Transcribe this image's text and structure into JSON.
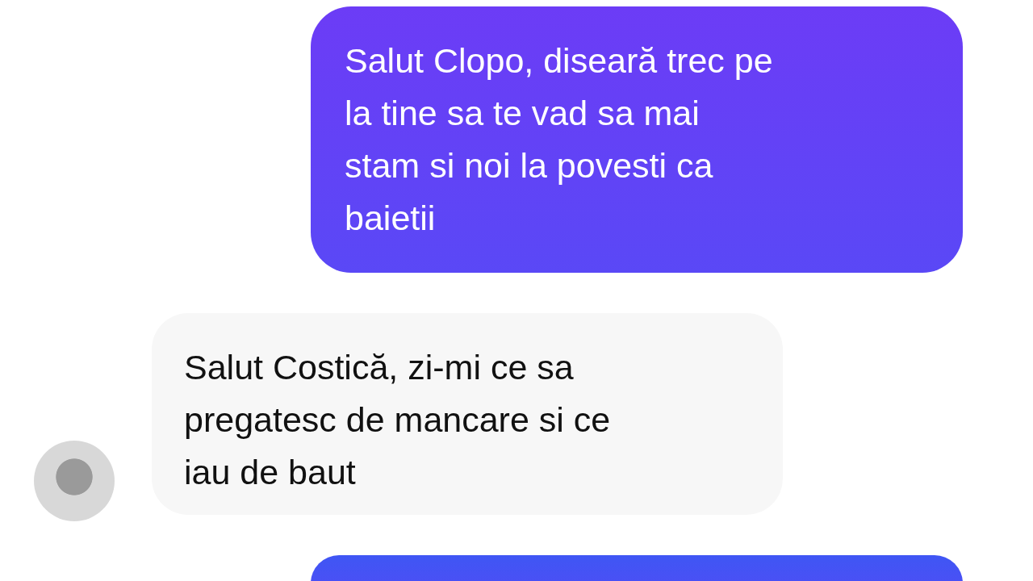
{
  "messages": [
    {
      "kind": "sent",
      "text": "Salut Clopo, diseară trec pe\nla tine sa te vad sa mai\nstam si noi la povesti ca\nbaietii"
    },
    {
      "kind": "received",
      "text": "Salut Costică, zi-mi ce sa\npregatesc de mancare si ce\niau de baut",
      "avatar": true
    },
    {
      "kind": "sent"
    }
  ]
}
